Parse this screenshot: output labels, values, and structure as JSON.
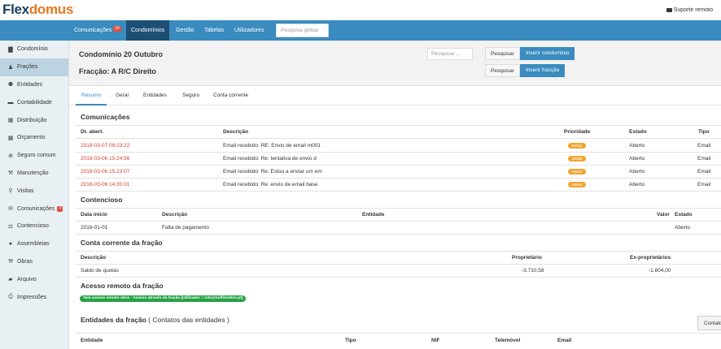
{
  "brand": {
    "part1": "Flex",
    "part2": "domus"
  },
  "topbar": {
    "remote_support": "Suporte remoto"
  },
  "nav": {
    "items": [
      {
        "label": "Comunicações",
        "badge": "10"
      },
      {
        "label": "Condomínios"
      },
      {
        "label": "Gestão"
      },
      {
        "label": "Tabelas"
      },
      {
        "label": "Utilizadores"
      }
    ],
    "search_placeholder": "Pesquisa global"
  },
  "sidebar": {
    "items": [
      {
        "label": "Condomínio",
        "icon": "building-icon"
      },
      {
        "label": "Frações",
        "icon": "user-icon"
      },
      {
        "label": "Entidades",
        "icon": "users-icon"
      },
      {
        "label": "Contabilidade",
        "icon": "money-icon"
      },
      {
        "label": "Distribuição",
        "icon": "calendar-icon"
      },
      {
        "label": "Orçamento",
        "icon": "calendar-icon"
      },
      {
        "label": "Seguro comum",
        "icon": "lifebuoy-icon"
      },
      {
        "label": "Manutenção",
        "icon": "wrench-icon"
      },
      {
        "label": "Visitas",
        "icon": "male-icon"
      },
      {
        "label": "Comunicações",
        "icon": "envelope-icon",
        "badge": "4"
      },
      {
        "label": "Contencioso",
        "icon": "scale-icon"
      },
      {
        "label": "Assembleias",
        "icon": "comment-icon"
      },
      {
        "label": "Obras",
        "icon": "hammer-icon"
      },
      {
        "label": "Arquivo",
        "icon": "folder-icon"
      },
      {
        "label": "Impressões",
        "icon": "print-icon"
      }
    ]
  },
  "header": {
    "title": "Condomínio 20 Outubro",
    "subtitle": "Fracção: A R/C Direito",
    "search_placeholder": "Pesquisar ...",
    "search_button": "Pesquisar",
    "insert_condo": "Inserir condomínio",
    "search_button2": "Pesquisar",
    "insert_fraction": "Inserir fracção"
  },
  "tabs": [
    "Resumo",
    "Geral",
    "Entidades",
    "Seguro",
    "Conta corrente"
  ],
  "communications": {
    "title": "Comunicações",
    "headers": {
      "date": "Dt. abert.",
      "description": "Descrição",
      "priority": "Prioridade",
      "status": "Estado",
      "type": "Tipo"
    },
    "rows": [
      {
        "date": "2018-03-07 09:23:22",
        "description": "Email recebido: RE: Envio de email m001",
        "priority": "Média",
        "status": "Aberto",
        "type": "Email"
      },
      {
        "date": "2018-03-06 15:24:56",
        "description": "Email recebido: Re: tentativa de envio d",
        "priority": "Média",
        "status": "Aberto",
        "type": "Email"
      },
      {
        "date": "2018-03-06 15:23:07",
        "description": "Email recebido: Re: Estou a enviar um em",
        "priority": "Média",
        "status": "Aberto",
        "type": "Email"
      },
      {
        "date": "2018-03-06 14:35:01",
        "description": "Email recebido: Re: envio de email base",
        "priority": "Média",
        "status": "Aberto",
        "type": "Email"
      }
    ]
  },
  "litigation": {
    "title": "Contencioso",
    "headers": {
      "start_date": "Data início",
      "description": "Descrição",
      "entity": "Entidade",
      "value": "Valor",
      "status": "Estado"
    },
    "rows": [
      {
        "start_date": "2018-01-01",
        "description": "Falta de pagamento",
        "status": "Aberto"
      }
    ]
  },
  "account": {
    "title": "Conta corrente da fração",
    "headers": {
      "description": "Descrição",
      "owner": "Proprietário",
      "ex_owners": "Ex-proprietários"
    },
    "rows": [
      {
        "description": "Saldo de quotas",
        "owner": "-3.710,58",
        "ex_owners": "-1.804,00"
      }
    ]
  },
  "remote_access": {
    "title": "Acesso remoto da fração",
    "badge": "Tem acesso remoto ativo · Acesso através da fração [Utilizador = info@softimotion.pt]"
  },
  "entities": {
    "title": "Entidades da fração",
    "subtitle": "( Contatos das entidades )",
    "button": "Contatos",
    "headers": {
      "entity": "Entidade",
      "type": "Tipo",
      "nif": "NIF",
      "mobile": "Telemóvel",
      "email": "Email"
    }
  },
  "colors": {
    "accent": "#3a8bbf",
    "nav_active": "#1d4e74",
    "badge": "#e34b3b",
    "priority": "#f0a531",
    "success": "#25a244",
    "date_red": "#d73c2c"
  }
}
